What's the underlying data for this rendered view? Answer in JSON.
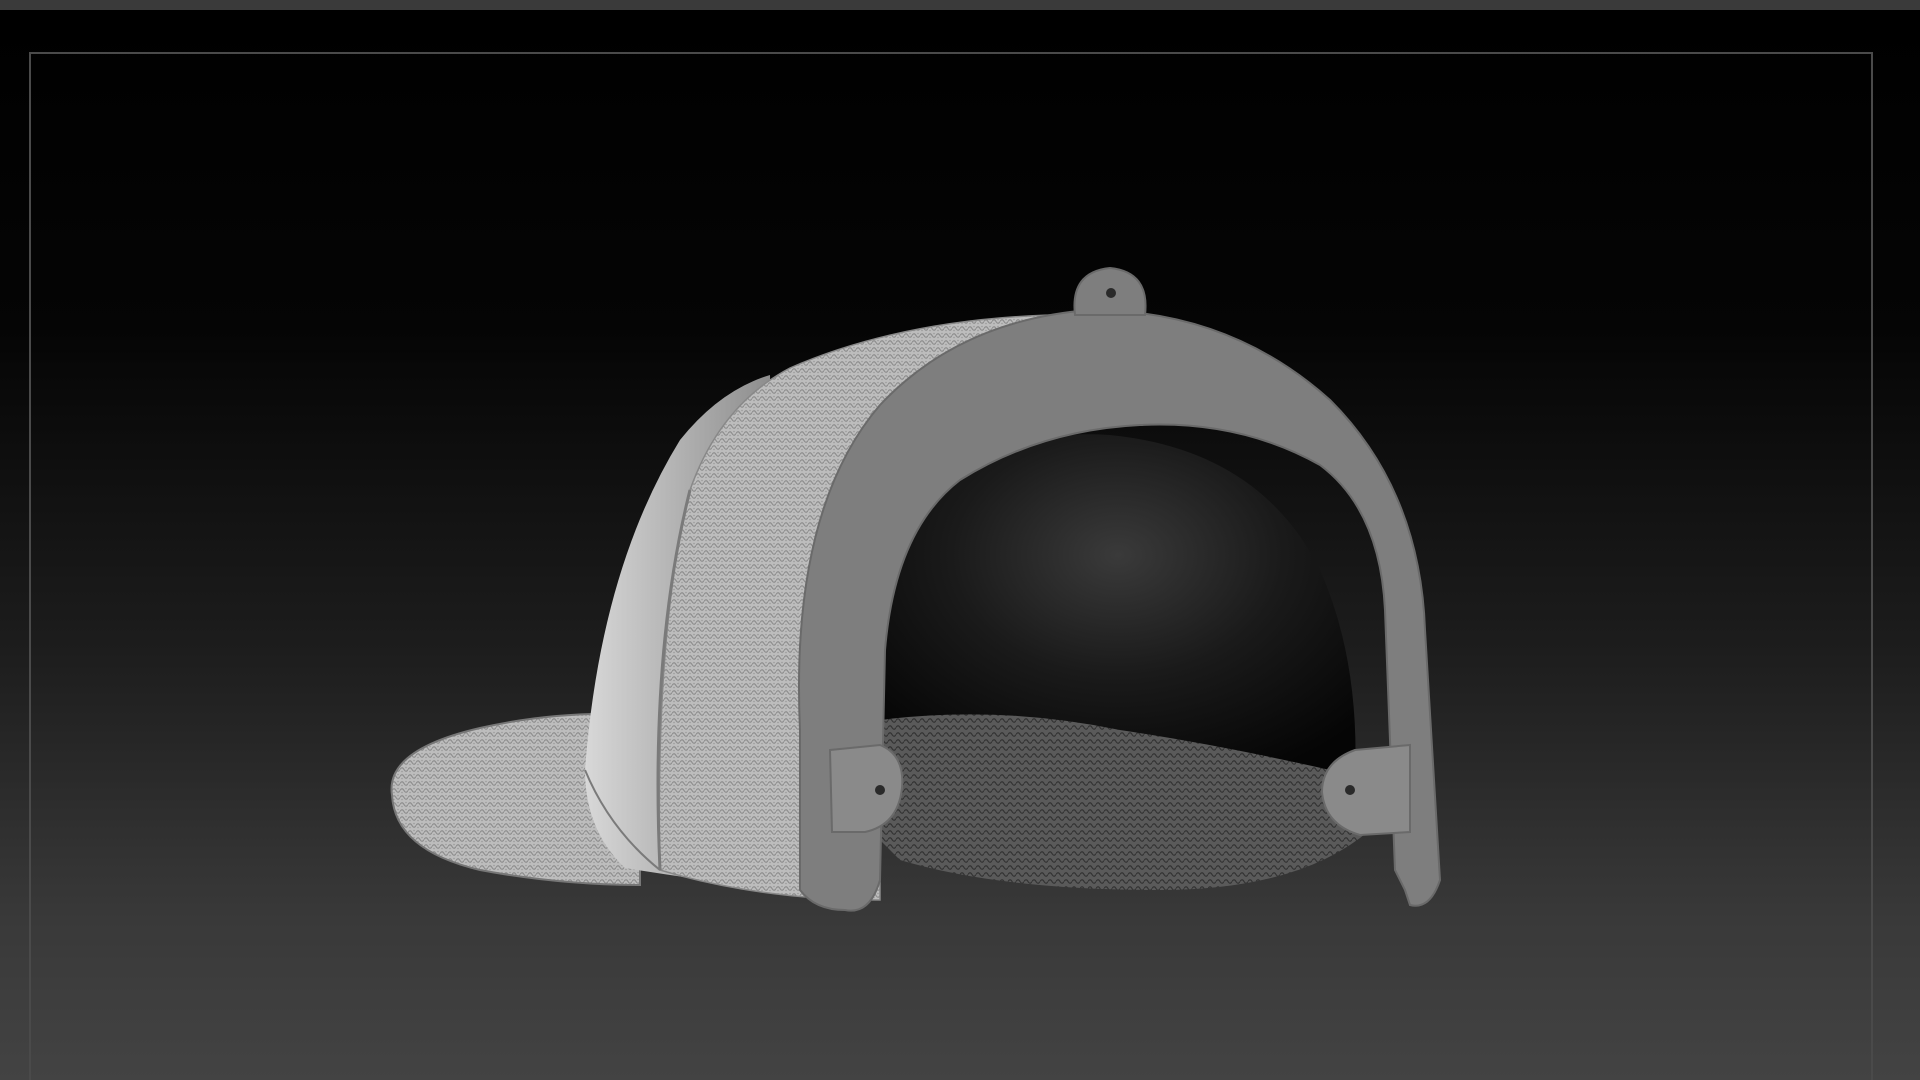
{
  "viewport": {
    "background_top": "#000000",
    "background_bottom": "#434343",
    "frame_color": "#4a4a4a"
  },
  "model": {
    "icon": "baseball-cap-3d-model",
    "material_color": "#8a8a8a",
    "highlight_color": "#c9c9c9"
  }
}
